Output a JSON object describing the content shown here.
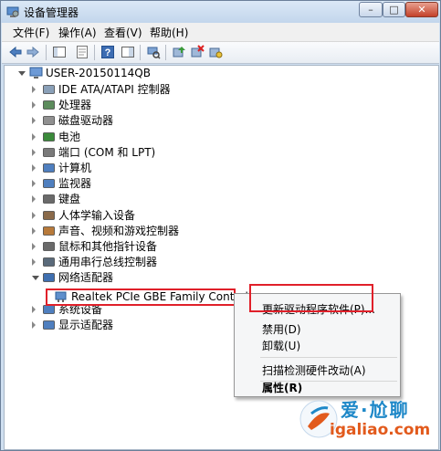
{
  "window": {
    "title": "设备管理器",
    "controls": {
      "minimize": "–",
      "maximize": "□",
      "close": "✕"
    }
  },
  "menubar": {
    "items": [
      "文件(F)",
      "操作(A)",
      "查看(V)",
      "帮助(H)"
    ]
  },
  "toolbar": {
    "buttons": [
      "back-icon",
      "forward-icon",
      "console-tree-icon",
      "properties-icon",
      "help-icon",
      "show-hide-icon",
      "scan-hardware-icon",
      "update-driver-icon",
      "disable-icon",
      "uninstall-icon"
    ]
  },
  "tree": {
    "root": "USER-20150114QB",
    "categories": [
      "IDE ATA/ATAPI 控制器",
      "处理器",
      "磁盘驱动器",
      "电池",
      "端口 (COM 和 LPT)",
      "计算机",
      "监视器",
      "键盘",
      "人体学输入设备",
      "声音、视频和游戏控制器",
      "鼠标和其他指针设备",
      "通用串行总线控制器",
      "网络适配器",
      "系统设备",
      "显示适配器"
    ],
    "network_child": "Realtek PCIe GBE Family Controlle"
  },
  "context_menu": {
    "update_driver": "更新驱动程序软件(P)...",
    "disable": "禁用(D)",
    "uninstall": "卸载(U)",
    "scan": "扫描检测硬件改动(A)",
    "properties": "属性(R)"
  },
  "watermark": {
    "text_cn": "爱·尬聊",
    "url": "igaliao.com"
  },
  "colors": {
    "highlight_border": "#e0202a",
    "watermark_blue": "#1e88c8",
    "watermark_orange": "#e25a1c"
  }
}
